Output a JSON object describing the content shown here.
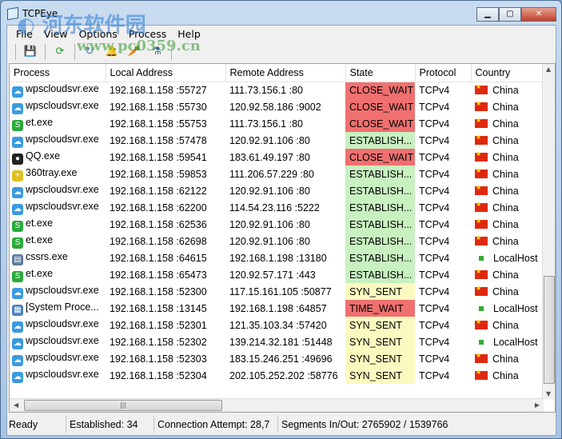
{
  "window": {
    "title": "TCPEye"
  },
  "watermark": {
    "text": "河东软件园",
    "url": "www.pc0359.cn"
  },
  "menu": [
    "File",
    "View",
    "Options",
    "Process",
    "Help"
  ],
  "toolbar": [
    "save-icon",
    "refresh-icon",
    "loop-icon",
    "bell-icon",
    "carrot-icon",
    "flask-icon"
  ],
  "columns": [
    "Process",
    "Local Address",
    "Remote Address",
    "State",
    "Protocol",
    "Country"
  ],
  "state_colors": {
    "CLOSE_WAIT": "#f07070",
    "ESTABLISHED": "#c8f0c0",
    "SYN_SENT": "#fafac0",
    "TIME_WAIT": "#f07070"
  },
  "rows": [
    {
      "process": "wpscloudsvr.exe",
      "icon": "cloud",
      "local": "192.168.1.158 :55727",
      "remote": "111.73.156.1 :80",
      "state": "CLOSE_WAIT",
      "stateKey": "CLOSE_WAIT",
      "protocol": "TCPv4",
      "country": "China"
    },
    {
      "process": "wpscloudsvr.exe",
      "icon": "cloud",
      "local": "192.168.1.158 :55730",
      "remote": "120.92.58.186 :9002",
      "state": "CLOSE_WAIT",
      "stateKey": "CLOSE_WAIT",
      "protocol": "TCPv4",
      "country": "China"
    },
    {
      "process": "et.exe",
      "icon": "et",
      "local": "192.168.1.158 :55753",
      "remote": "111.73.156.1 :80",
      "state": "CLOSE_WAIT",
      "stateKey": "CLOSE_WAIT",
      "protocol": "TCPv4",
      "country": "China"
    },
    {
      "process": "wpscloudsvr.exe",
      "icon": "cloud",
      "local": "192.168.1.158 :57478",
      "remote": "120.92.91.106 :80",
      "state": "ESTABLISH...",
      "stateKey": "ESTABLISHED",
      "protocol": "TCPv4",
      "country": "China"
    },
    {
      "process": "QQ.exe",
      "icon": "qq",
      "local": "192.168.1.158 :59541",
      "remote": "183.61.49.197 :80",
      "state": "CLOSE_WAIT",
      "stateKey": "CLOSE_WAIT",
      "protocol": "TCPv4",
      "country": "China"
    },
    {
      "process": "360tray.exe",
      "icon": "360",
      "local": "192.168.1.158 :59853",
      "remote": "111.206.57.229 :80",
      "state": "ESTABLISH...",
      "stateKey": "ESTABLISHED",
      "protocol": "TCPv4",
      "country": "China"
    },
    {
      "process": "wpscloudsvr.exe",
      "icon": "cloud",
      "local": "192.168.1.158 :62122",
      "remote": "120.92.91.106 :80",
      "state": "ESTABLISH...",
      "stateKey": "ESTABLISHED",
      "protocol": "TCPv4",
      "country": "China"
    },
    {
      "process": "wpscloudsvr.exe",
      "icon": "cloud",
      "local": "192.168.1.158 :62200",
      "remote": "114.54.23.116 :5222",
      "state": "ESTABLISH...",
      "stateKey": "ESTABLISHED",
      "protocol": "TCPv4",
      "country": "China"
    },
    {
      "process": "et.exe",
      "icon": "et",
      "local": "192.168.1.158 :62536",
      "remote": "120.92.91.106 :80",
      "state": "ESTABLISH...",
      "stateKey": "ESTABLISHED",
      "protocol": "TCPv4",
      "country": "China"
    },
    {
      "process": "et.exe",
      "icon": "et",
      "local": "192.168.1.158 :62698",
      "remote": "120.92.91.106 :80",
      "state": "ESTABLISH...",
      "stateKey": "ESTABLISHED",
      "protocol": "TCPv4",
      "country": "China"
    },
    {
      "process": "cssrs.exe",
      "icon": "app",
      "local": "192.168.1.158 :64615",
      "remote": "192.168.1.198 :13180",
      "state": "ESTABLISH...",
      "stateKey": "ESTABLISHED",
      "protocol": "TCPv4",
      "country": "LocalHost"
    },
    {
      "process": "et.exe",
      "icon": "et",
      "local": "192.168.1.158 :65473",
      "remote": "120.92.57.171 :443",
      "state": "ESTABLISH...",
      "stateKey": "ESTABLISHED",
      "protocol": "TCPv4",
      "country": "China"
    },
    {
      "process": "wpscloudsvr.exe",
      "icon": "cloud",
      "local": "192.168.1.158 :52300",
      "remote": "117.15.161.105 :50877",
      "state": "SYN_SENT",
      "stateKey": "SYN_SENT",
      "protocol": "TCPv4",
      "country": "China"
    },
    {
      "process": "[System Proce...",
      "icon": "sys",
      "local": "192.168.1.158 :13145",
      "remote": "192.168.1.198 :64857",
      "state": "TIME_WAIT",
      "stateKey": "TIME_WAIT",
      "protocol": "TCPv4",
      "country": "LocalHost"
    },
    {
      "process": "wpscloudsvr.exe",
      "icon": "cloud",
      "local": "192.168.1.158 :52301",
      "remote": "121.35.103.34 :57420",
      "state": "SYN_SENT",
      "stateKey": "SYN_SENT",
      "protocol": "TCPv4",
      "country": "China"
    },
    {
      "process": "wpscloudsvr.exe",
      "icon": "cloud",
      "local": "192.168.1.158 :52302",
      "remote": "139.214.32.181 :51448",
      "state": "SYN_SENT",
      "stateKey": "SYN_SENT",
      "protocol": "TCPv4",
      "country": "LocalHost"
    },
    {
      "process": "wpscloudsvr.exe",
      "icon": "cloud",
      "local": "192.168.1.158 :52303",
      "remote": "183.15.246.251 :49696",
      "state": "SYN_SENT",
      "stateKey": "SYN_SENT",
      "protocol": "TCPv4",
      "country": "China"
    },
    {
      "process": "wpscloudsvr.exe",
      "icon": "cloud",
      "local": "192.168.1.158 :52304",
      "remote": "202.105.252.202 :58776",
      "state": "SYN_SENT",
      "stateKey": "SYN_SENT",
      "protocol": "TCPv4",
      "country": "China"
    }
  ],
  "status": {
    "ready": "Ready",
    "established": "Established: 34",
    "attempt": "Connection Attempt: 28,7",
    "segments": "Segments In/Out: 2765902 / 1539766"
  }
}
